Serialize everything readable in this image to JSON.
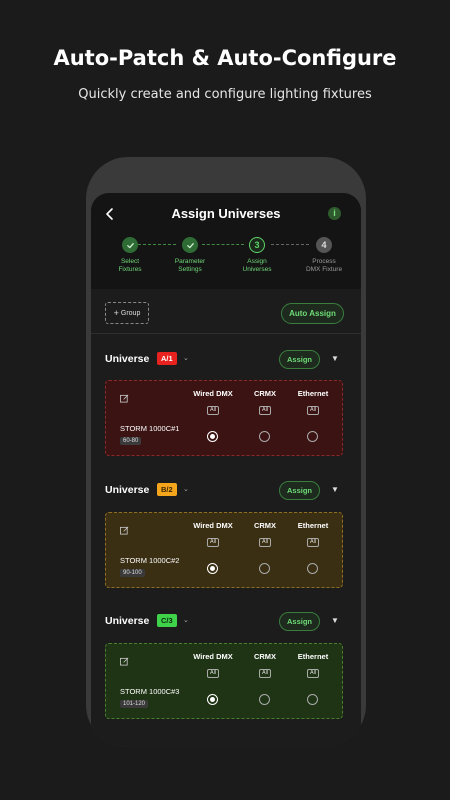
{
  "hero": {
    "title": "Auto-Patch & Auto-Configure",
    "subtitle": "Quickly create and configure lighting fixtures"
  },
  "screen": {
    "title": "Assign Universes",
    "info_glyph": "i",
    "back_icon": "chevron-left-icon"
  },
  "steps": [
    {
      "number": "1",
      "line1": "Select",
      "line2": "Fixtures",
      "state": "done"
    },
    {
      "number": "2",
      "line1": "Parameter",
      "line2": "Settings",
      "state": "done"
    },
    {
      "number": "3",
      "line1": "Assign",
      "line2": "Universes",
      "state": "current"
    },
    {
      "number": "4",
      "line1": "Process",
      "line2": "DMX Fixture",
      "state": "pending"
    }
  ],
  "toolbar": {
    "group_label": "Group",
    "auto_assign_label": "Auto Assign"
  },
  "columns": [
    {
      "name": "Wired DMX",
      "tag": "All"
    },
    {
      "name": "CRMX",
      "tag": "All"
    },
    {
      "name": "Ethernet",
      "tag": "All"
    }
  ],
  "universes": [
    {
      "label": "Universe",
      "badge": "A/1",
      "badge_color": "#e8231f",
      "badge_text_color": "#ffffff",
      "assign_label": "Assign",
      "card_bg": "#3b1313",
      "card_border": "#8a2a2a",
      "fixture": {
        "name": "STORM 1000C#1",
        "range": "60-80"
      },
      "selected_column": 0
    },
    {
      "label": "Universe",
      "badge": "B/2",
      "badge_color": "#f4a51c",
      "badge_text_color": "#3a2500",
      "assign_label": "Assign",
      "card_bg": "#3a2e13",
      "card_border": "#8d6e24",
      "fixture": {
        "name": "STORM 1000C#2",
        "range": "90-100"
      },
      "selected_column": 0
    },
    {
      "label": "Universe",
      "badge": "C/3",
      "badge_color": "#3fd34a",
      "badge_text_color": "#0d2a0f",
      "assign_label": "Assign",
      "card_bg": "#1f3415",
      "card_border": "#4a7d2f",
      "fixture": {
        "name": "STORM 1000C#3",
        "range": "101-120"
      },
      "selected_column": 0
    }
  ]
}
